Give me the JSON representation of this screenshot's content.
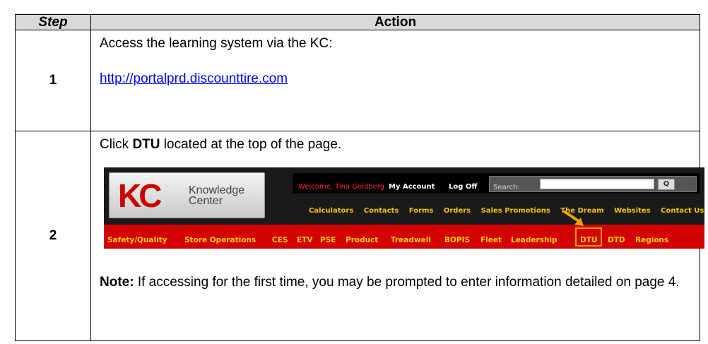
{
  "table": {
    "header_step": "Step",
    "header_action": "Action",
    "rows": [
      {
        "step": "1",
        "text": "Access the learning system via the KC:",
        "link": "http://portalprd.discounttire.com"
      },
      {
        "step": "2",
        "instruction_pre": "Click ",
        "instruction_bold": "DTU",
        "instruction_post": " located at the top of the page.",
        "note_label": "Note:",
        "note_text": " If accessing for the first time, you may be prompted to enter information detailed on page 4."
      }
    ]
  },
  "kc_screenshot": {
    "logo_letters": "KC",
    "logo_line1": "Knowledge",
    "logo_line2": "Center",
    "welcome": "Welcome, Tina Goldberg",
    "my_account": "My Account",
    "log_off": "Log Off",
    "search_label": "Search:",
    "search_button": "Q",
    "sub_nav": [
      "Calculators",
      "Contacts",
      "Forms",
      "Orders",
      "Sales Promotions",
      "The Dream",
      "Websites",
      "Contact Us"
    ],
    "main_nav": [
      "Safety/Quality",
      "Store Operations",
      "CES",
      "ETV",
      "PSE",
      "Product",
      "Treadwell",
      "BOPIS",
      "Fleet",
      "Leadership",
      "DTU",
      "DTD",
      "Regions"
    ],
    "highlight_color": "#f0a000",
    "nav_color": "#d40000"
  }
}
